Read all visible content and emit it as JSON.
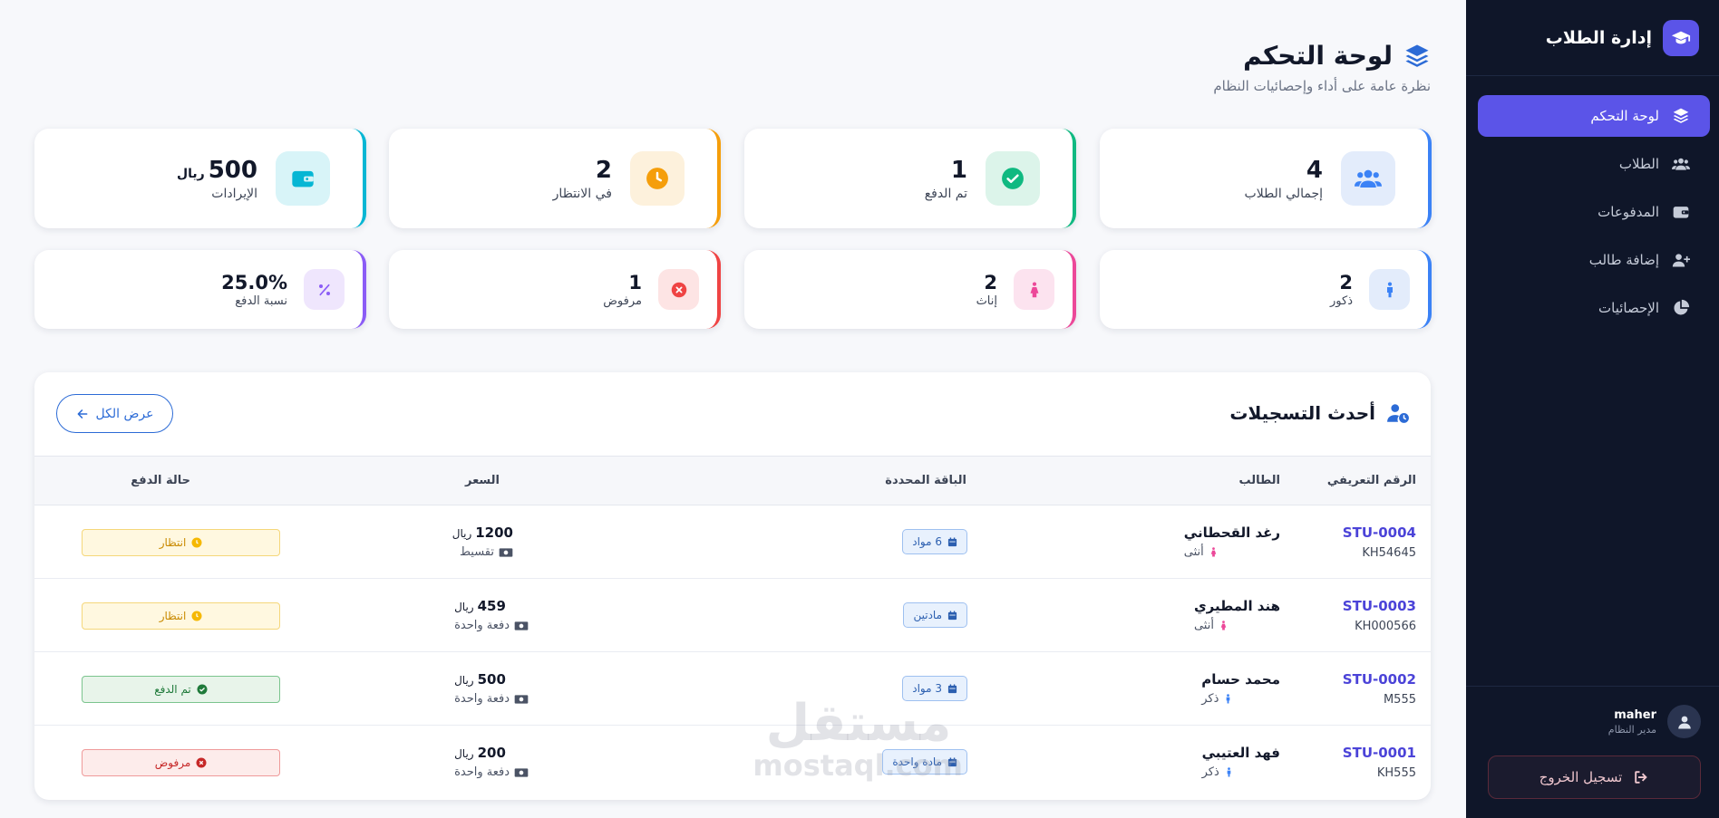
{
  "sidebar": {
    "brand_title": "إدارة الطلاب",
    "items": [
      {
        "label": "لوحة التحكم",
        "icon": "layers-icon",
        "active": true
      },
      {
        "label": "الطلاب",
        "icon": "users-icon"
      },
      {
        "label": "المدفوعات",
        "icon": "wallet-icon"
      },
      {
        "label": "إضافة طالب",
        "icon": "user-plus-icon"
      },
      {
        "label": "الإحصائيات",
        "icon": "pie-chart-icon"
      }
    ],
    "user": {
      "name": "maher",
      "role": "مدير النظام"
    },
    "logout_label": "تسجيل الخروج"
  },
  "header": {
    "title": "لوحة التحكم",
    "subtitle": "نظرة عامة على أداء وإحصائيات النظام"
  },
  "stats_top": [
    {
      "value": "4",
      "label": "إجمالي الطلاب",
      "icon": "users-icon",
      "accent": "#3b82f6"
    },
    {
      "value": "1",
      "label": "تم الدفع",
      "icon": "check-circle-icon",
      "accent": "#10b981"
    },
    {
      "value": "2",
      "label": "في الانتظار",
      "icon": "clock-icon",
      "accent": "#f59e0b"
    },
    {
      "value": "500",
      "unit": "ريال",
      "label": "الإيرادات",
      "icon": "wallet-icon",
      "accent": "#06b6d4"
    }
  ],
  "stats_bottom": [
    {
      "value": "2",
      "label": "ذكور",
      "icon": "male-icon",
      "accent": "#3b82f6"
    },
    {
      "value": "2",
      "label": "إناث",
      "icon": "female-icon",
      "accent": "#ec4899"
    },
    {
      "value": "1",
      "label": "مرفوض",
      "icon": "x-circle-icon",
      "accent": "#ef4444"
    },
    {
      "value": "25.0%",
      "label": "نسبة الدفع",
      "icon": "percent-icon",
      "accent": "#8b5cf6"
    }
  ],
  "recent": {
    "title": "أحدث التسجيلات",
    "view_all_label": "عرض الكل",
    "columns": [
      "الرقم التعريفي",
      "الطالب",
      "الباقة المحددة",
      "السعر",
      "حالة الدفع"
    ],
    "rows": [
      {
        "id": "STU-0004",
        "code": "KH54645",
        "name": "رغد القحطاني",
        "gender": "أنثى",
        "package": "6 مواد",
        "price": "1200",
        "currency": "ريال",
        "payment_type": "تقسيط",
        "status": "انتظار",
        "status_kind": "pending"
      },
      {
        "id": "STU-0003",
        "code": "KH000566",
        "name": "هند المطيري",
        "gender": "أنثى",
        "package": "مادتين",
        "price": "459",
        "currency": "ريال",
        "payment_type": "دفعة واحدة",
        "status": "انتظار",
        "status_kind": "pending"
      },
      {
        "id": "STU-0002",
        "code": "M555",
        "name": "محمد حسام",
        "gender": "ذكر",
        "package": "3 مواد",
        "price": "500",
        "currency": "ريال",
        "payment_type": "دفعة واحدة",
        "status": "تم الدفع",
        "status_kind": "paid"
      },
      {
        "id": "STU-0001",
        "code": "KH555",
        "name": "فهد العتيبي",
        "gender": "ذكر",
        "package": "مادة واحدة",
        "price": "200",
        "currency": "ريال",
        "payment_type": "دفعة واحدة",
        "status": "مرفوض",
        "status_kind": "rejected"
      }
    ]
  },
  "watermark": {
    "arabic": "مستقل",
    "latin": "mostaql.com"
  }
}
